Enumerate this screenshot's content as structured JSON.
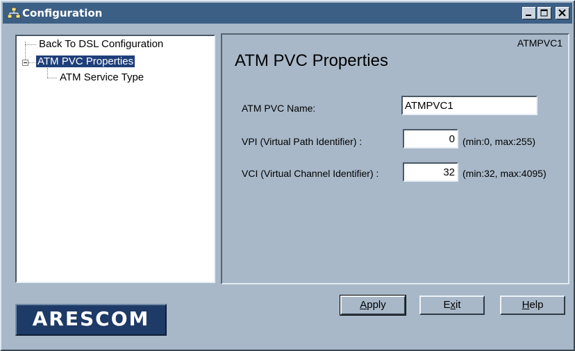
{
  "window": {
    "title": "Configuration",
    "controls": {
      "minimize": "_",
      "maximize": "□",
      "close": "×"
    }
  },
  "tree": {
    "items": [
      {
        "label": "Back To DSL Configuration"
      },
      {
        "label": "ATM PVC Properties",
        "selected": true
      },
      {
        "label": "ATM Service Type"
      }
    ]
  },
  "panel": {
    "tag": "ATMPVC1",
    "title": "ATM PVC Properties",
    "fields": [
      {
        "label": "ATM PVC Name:",
        "value": "ATMPVC1",
        "range": ""
      },
      {
        "label": "VPI (Virtual Path Identifier) :",
        "value": "0",
        "range": "(min:0, max:255)"
      },
      {
        "label": "VCI (Virtual Channel Identifier) :",
        "value": "32",
        "range": "(min:32, max:4095)"
      }
    ]
  },
  "buttons": {
    "apply": {
      "first": "A",
      "rest": "pply"
    },
    "exit": {
      "first": "E",
      "mid": "x",
      "rest": "it"
    },
    "help": {
      "first": "H",
      "rest": "elp"
    }
  },
  "logo": {
    "text": "ARESCOM"
  },
  "colors": {
    "background": "#a8b8c8",
    "titlebar": "#3c5f85",
    "selection": "#1f3f7a",
    "logo": "#1e3a66"
  }
}
